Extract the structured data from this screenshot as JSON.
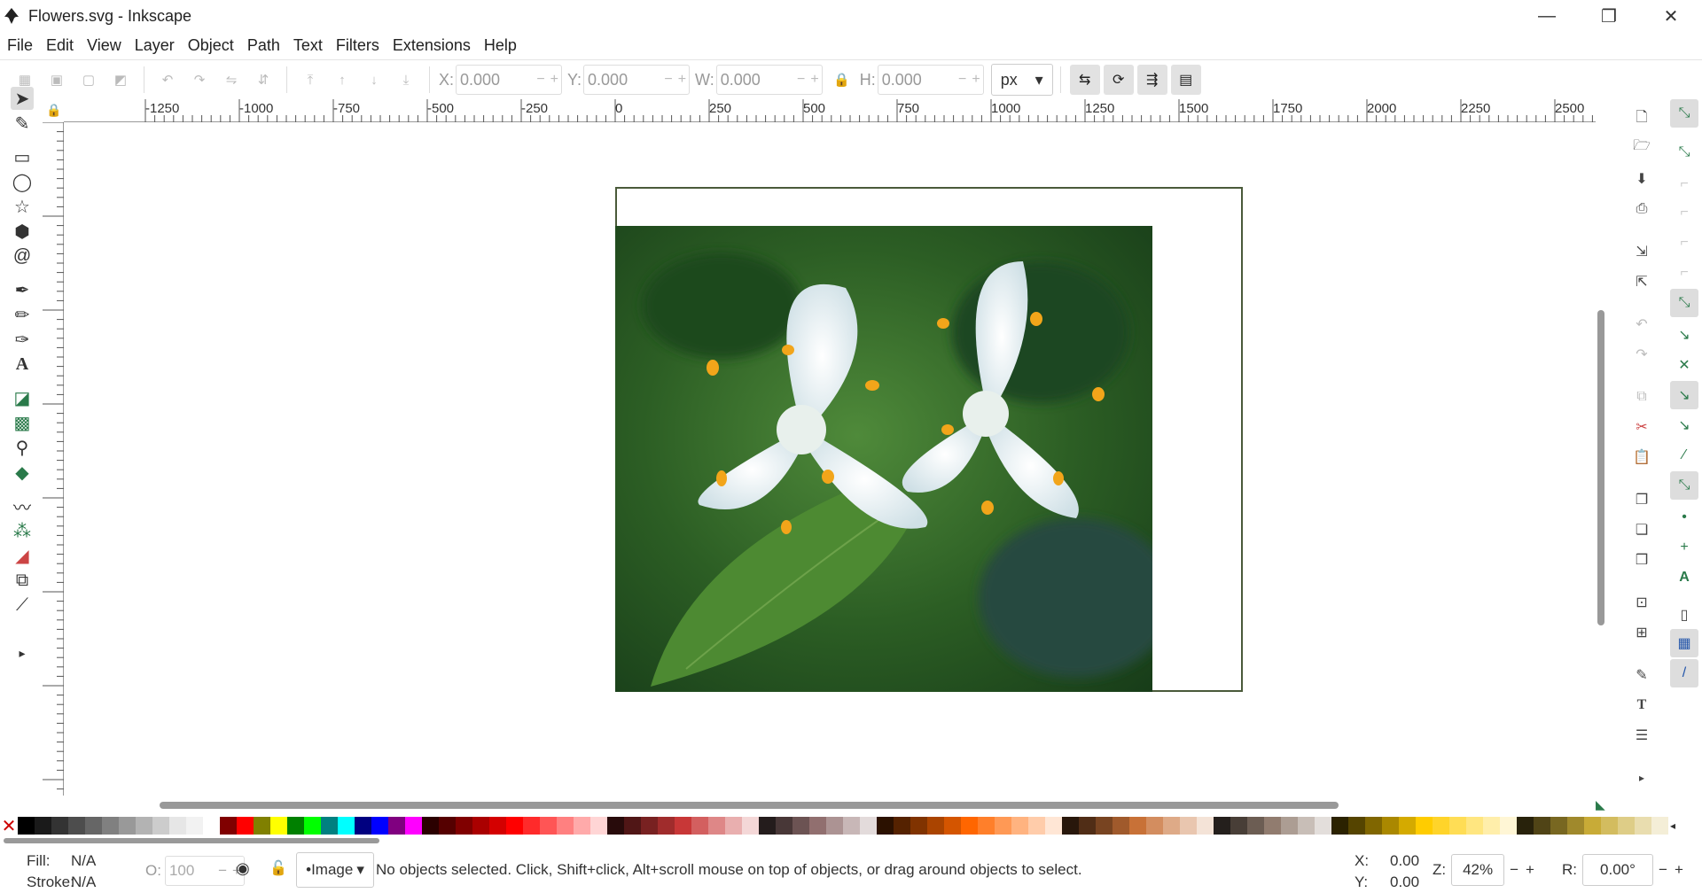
{
  "window": {
    "title": "Flowers.svg - Inkscape",
    "minimize": "—",
    "maximize": "❐",
    "close": "✕"
  },
  "menu": [
    "File",
    "Edit",
    "View",
    "Layer",
    "Object",
    "Path",
    "Text",
    "Filters",
    "Extensions",
    "Help"
  ],
  "toolbar": {
    "x_label": "X:",
    "x_value": "0.000",
    "y_label": "Y:",
    "y_value": "0.000",
    "w_label": "W:",
    "w_value": "0.000",
    "h_label": "H:",
    "h_value": "0.000",
    "unit": "px"
  },
  "ruler": {
    "top_labels": [
      "-1250",
      "-1000",
      "-750",
      "-500",
      "-250",
      "0",
      "250",
      "500",
      "750",
      "1000",
      "1250",
      "1500",
      "1750",
      "2000",
      "2250",
      "2500"
    ]
  },
  "canvas": {
    "image_subject": "two white flowers with yellow stamens on green leaves"
  },
  "palette": {
    "colors": [
      "#000000",
      "#1a1a1a",
      "#333333",
      "#4d4d4d",
      "#666666",
      "#808080",
      "#999999",
      "#b3b3b3",
      "#cccccc",
      "#e6e6e6",
      "#f2f2f2",
      "#ffffff",
      "#800000",
      "#ff0000",
      "#808000",
      "#ffff00",
      "#008000",
      "#00ff00",
      "#008080",
      "#00ffff",
      "#000080",
      "#0000ff",
      "#800080",
      "#ff00ff",
      "#2b0000",
      "#550000",
      "#800000",
      "#aa0000",
      "#d40000",
      "#ff0000",
      "#ff2a2a",
      "#ff5555",
      "#ff8080",
      "#ffaaaa",
      "#ffd5d5",
      "#280b0b",
      "#501616",
      "#782121",
      "#a02c2c",
      "#c83737",
      "#d35f5f",
      "#de8787",
      "#e9afaf",
      "#f4d7d7",
      "#241c1c",
      "#483737",
      "#6c5353",
      "#916f6f",
      "#ac9393",
      "#c8b7b7",
      "#e3dbdb",
      "#2b1100",
      "#552200",
      "#803300",
      "#aa4400",
      "#d45500",
      "#ff6600",
      "#ff7f2a",
      "#ff9955",
      "#ffb380",
      "#ffccaa",
      "#ffe6d5",
      "#28170b",
      "#502d16",
      "#784421",
      "#a05a2c",
      "#c87137",
      "#d38d5f",
      "#deaa87",
      "#e9c6af",
      "#f4e3d7",
      "#241f1c",
      "#483e37",
      "#6c5d53",
      "#917c6f",
      "#ac9d93",
      "#c8beb7",
      "#e3dedb",
      "#2b2200",
      "#554400",
      "#806600",
      "#aa8800",
      "#d4aa00",
      "#ffcc00",
      "#ffd42a",
      "#ffdd55",
      "#ffe680",
      "#ffeeaa",
      "#fff6d5",
      "#28220b",
      "#504416",
      "#786721",
      "#a0892c",
      "#c8ab37",
      "#d3bc5f",
      "#decd87",
      "#e9ddaf",
      "#f4eed7"
    ]
  },
  "status": {
    "fill_label": "Fill:",
    "fill_value": "N/A",
    "stroke_label": "Stroke:",
    "stroke_value": "N/A",
    "opacity_label": "O:",
    "opacity_value": "100",
    "layer": "•Image",
    "message": "No objects selected. Click, Shift+click, Alt+scroll mouse on top of objects, or drag around objects to select.",
    "x_label": "X:",
    "x_value": "0.00",
    "y_label": "Y:",
    "y_value": "0.00",
    "zoom_label": "Z:",
    "zoom_value": "42%",
    "rotation_label": "R:",
    "rotation_value": "0.00°"
  }
}
